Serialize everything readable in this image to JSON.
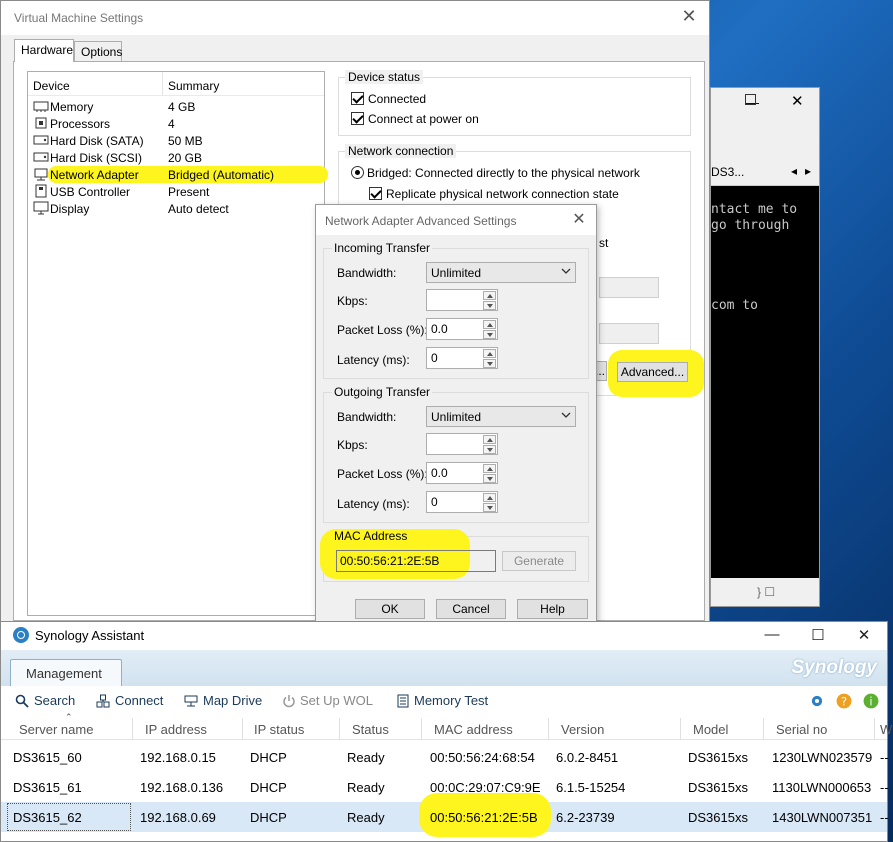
{
  "vm": {
    "title": "Virtual Machine Settings",
    "tabs": [
      "Hardware",
      "Options"
    ],
    "device_header": "Device",
    "summary_header": "Summary",
    "devices": [
      {
        "name": "Memory",
        "summary": "4 GB",
        "icon": "memory-icon"
      },
      {
        "name": "Processors",
        "summary": "4",
        "icon": "processor-icon"
      },
      {
        "name": "Hard Disk (SATA)",
        "summary": "50 MB",
        "icon": "hard-disk-icon"
      },
      {
        "name": "Hard Disk (SCSI)",
        "summary": "20 GB",
        "icon": "hard-disk-icon"
      },
      {
        "name": "Network Adapter",
        "summary": "Bridged (Automatic)",
        "icon": "network-adapter-icon"
      },
      {
        "name": "USB Controller",
        "summary": "Present",
        "icon": "usb-icon"
      },
      {
        "name": "Display",
        "summary": "Auto detect",
        "icon": "display-icon"
      }
    ],
    "device_status": {
      "title": "Device status",
      "connected": "Connected",
      "connect_power_on": "Connect at power on"
    },
    "network_connection": {
      "title": "Network connection",
      "bridged": "Bridged: Connected directly to the physical network",
      "replicate": "Replicate physical network connection state",
      "partial_text": "st"
    },
    "advanced_button": "Advanced...",
    "partial_button": "..."
  },
  "console": {
    "tab_label": "DS3...",
    "lines": [
      "ntact me to",
      " go through",
      "com to"
    ],
    "bottom_glyphs": "} ☐"
  },
  "adv": {
    "title": "Network Adapter Advanced Settings",
    "incoming": {
      "title": "Incoming Transfer",
      "bandwidth_label": "Bandwidth:",
      "bandwidth_value": "Unlimited",
      "kbps_label": "Kbps:",
      "kbps_value": "",
      "loss_label": "Packet Loss (%):",
      "loss_value": "0.0",
      "latency_label": "Latency (ms):",
      "latency_value": "0"
    },
    "outgoing": {
      "title": "Outgoing Transfer",
      "bandwidth_label": "Bandwidth:",
      "bandwidth_value": "Unlimited",
      "kbps_label": "Kbps:",
      "kbps_value": "",
      "loss_label": "Packet Loss (%):",
      "loss_value": "0.0",
      "latency_label": "Latency (ms):",
      "latency_value": "0"
    },
    "mac": {
      "title": "MAC Address",
      "value": "00:50:56:21:2E:5B",
      "generate": "Generate"
    },
    "ok": "OK",
    "cancel": "Cancel",
    "help": "Help"
  },
  "syn": {
    "title": "Synology Assistant",
    "tab": "Management",
    "brand": "Synology",
    "toolbar": {
      "search": "Search",
      "connect": "Connect",
      "map_drive": "Map Drive",
      "wol": "Set Up WOL",
      "memory_test": "Memory Test"
    },
    "columns": [
      "Server name",
      "IP address",
      "IP status",
      "Status",
      "MAC address",
      "Version",
      "Model",
      "Serial no",
      "W"
    ],
    "rows": [
      [
        "DS3615_60",
        "192.168.0.15",
        "DHCP",
        "Ready",
        "00:50:56:24:68:54",
        "6.0.2-8451",
        "DS3615xs",
        "1230LWN023579",
        "--"
      ],
      [
        "DS3615_61",
        "192.168.0.136",
        "DHCP",
        "Ready",
        "00:0C:29:07:C9:9E",
        "6.1.5-15254",
        "DS3615xs",
        "1130LWN000653",
        "--"
      ],
      [
        "DS3615_62",
        "192.168.0.69",
        "DHCP",
        "Ready",
        "00:50:56:21:2E:5B",
        "6.2-23739",
        "DS3615xs",
        "1430LWN007351",
        "--"
      ]
    ]
  },
  "colors": {
    "highlight": "#fdf51d",
    "selected_row": "#d9e8f7",
    "accent": "#2b7fc4"
  }
}
